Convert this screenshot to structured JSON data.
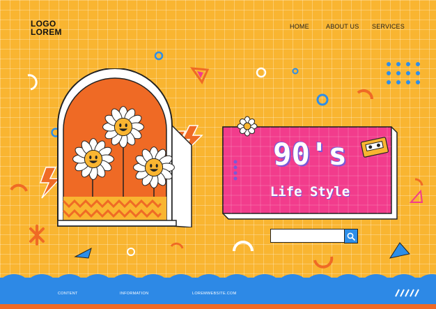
{
  "header": {
    "logo_line1": "LOGO",
    "logo_line2": "LOREM",
    "nav": [
      {
        "label": "HOME"
      },
      {
        "label": "ABOUT US"
      },
      {
        "label": "SERVICES"
      }
    ]
  },
  "banner": {
    "title": "90's",
    "subtitle": "Life Style"
  },
  "search": {
    "value": "",
    "icon": "magnifier-icon"
  },
  "footer": {
    "links": [
      {
        "label": "CONTENT"
      },
      {
        "label": "INFORMATION"
      },
      {
        "label": "LOREMWEBSITE.COM"
      }
    ]
  },
  "colors": {
    "background": "#f9b531",
    "arch": "#ef6a25",
    "banner": "#f23c8c",
    "footer": "#2d89e6",
    "accent_blue": "#2d8ee8"
  }
}
